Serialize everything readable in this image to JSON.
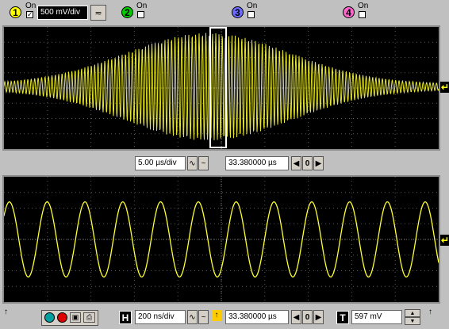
{
  "channels": [
    {
      "number": "1",
      "on_label": "On",
      "checked": true,
      "color": "#ffff00",
      "scale": "500 mV/div",
      "coupling_icon": "ac-dc-coupling-icon"
    },
    {
      "number": "2",
      "on_label": "On",
      "checked": false,
      "color": "#00cc00"
    },
    {
      "number": "3",
      "on_label": "On",
      "checked": false,
      "color": "#6a6aff"
    },
    {
      "number": "4",
      "on_label": "On",
      "checked": false,
      "color": "#ff66cc"
    }
  ],
  "main_timebase": {
    "scale": "5.00 µs/div",
    "position": "33.380000 µs",
    "nav_value": "0"
  },
  "bottom_bar": {
    "horizontal_label": "H",
    "zoom_timebase": "200 ns/div",
    "zoom_position": "33.380000 µs",
    "nav_value": "0",
    "trigger_label": "T",
    "trigger_level": "597 mV",
    "trigger_marker": "↑",
    "run_color": "#00a0a0",
    "stop_color": "#dd0000"
  },
  "waveform": {
    "trace_color": "#ffff33",
    "grid_color": "#5a5a5a",
    "ground_marker": "↵",
    "burst_cycles": 130,
    "zoom_cycles": 11.5
  }
}
